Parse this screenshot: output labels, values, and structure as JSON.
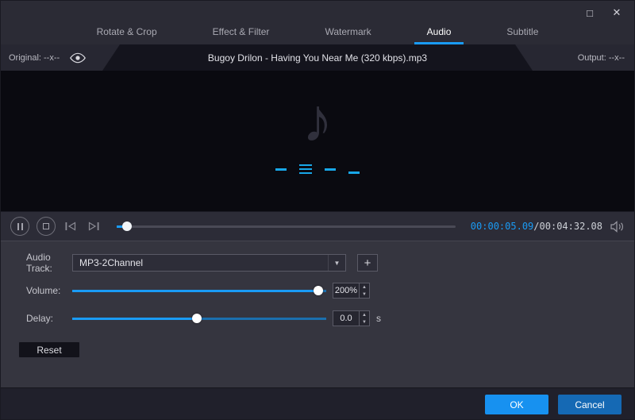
{
  "window": {
    "maximize_icon": "□",
    "close_icon": "✕"
  },
  "tabs": [
    {
      "label": "Rotate & Crop",
      "active": false
    },
    {
      "label": "Effect & Filter",
      "active": false
    },
    {
      "label": "Watermark",
      "active": false
    },
    {
      "label": "Audio",
      "active": true
    },
    {
      "label": "Subtitle",
      "active": false
    }
  ],
  "preview_header": {
    "original_label": "Original: --x--",
    "title": "Bugoy Drilon - Having You Near Me (320 kbps).mp3",
    "output_label": "Output: --x--"
  },
  "preview": {
    "note_icon": "♪"
  },
  "player": {
    "progress_pct": 3,
    "time_current": "00:00:05.09",
    "time_separator": "/",
    "time_total": "00:04:32.08"
  },
  "form": {
    "audio_track": {
      "label": "Audio Track:",
      "value": "MP3-2Channel",
      "arrow_icon": "▼",
      "add_icon": "+"
    },
    "volume": {
      "label": "Volume:",
      "value": "200%",
      "slider_pct": 97
    },
    "delay": {
      "label": "Delay:",
      "value": "0.0",
      "unit": "s",
      "slider_pct": 49
    },
    "spinner_up_icon": "▲",
    "spinner_down_icon": "▼",
    "reset_label": "Reset"
  },
  "footer": {
    "ok_label": "OK",
    "cancel_label": "Cancel"
  },
  "colors": {
    "accent": "#1a9bf5"
  }
}
